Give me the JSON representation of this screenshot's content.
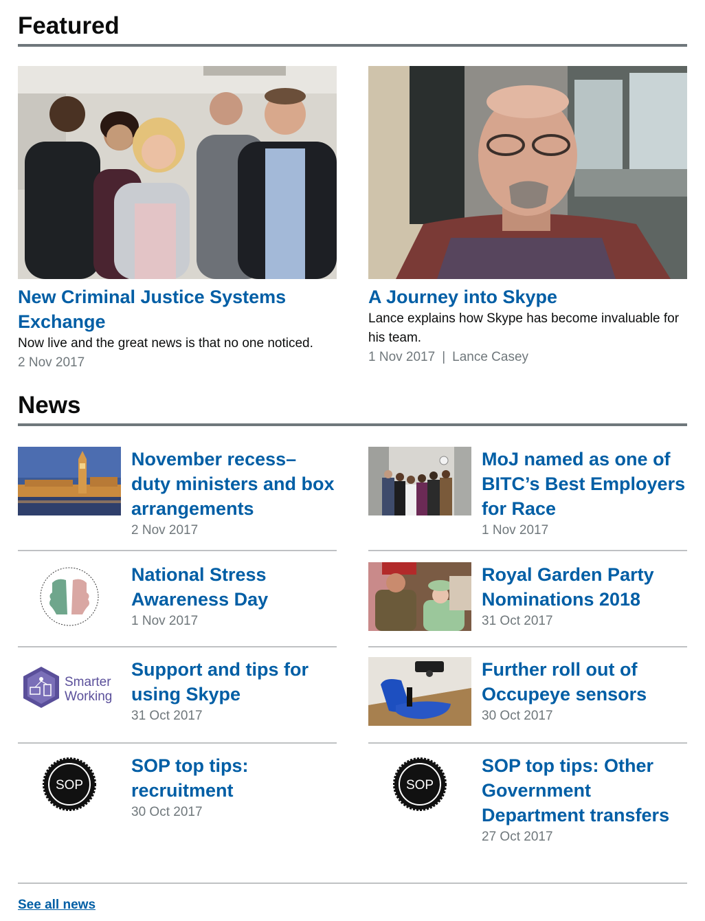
{
  "featured": {
    "heading": "Featured",
    "items": [
      {
        "title": "New Criminal Justice Systems Exchange",
        "description": "Now live and the great news is that no one noticed.",
        "date": "2 Nov 2017",
        "author": ""
      },
      {
        "title": "A Journey into Skype",
        "description": "Lance explains how Skype has become invaluable for his team.",
        "date": "1 Nov 2017",
        "separator": "|",
        "author": "Lance Casey"
      }
    ]
  },
  "news": {
    "heading": "News",
    "items": [
      {
        "title": "November recess– duty ministers and box arrangements",
        "date": "2 Nov 2017"
      },
      {
        "title": "MoJ named as one of BITC’s Best Employers for Race",
        "date": "1 Nov 2017"
      },
      {
        "title": "National Stress Awareness Day",
        "date": "1 Nov 2017"
      },
      {
        "title": "Royal Garden Party Nominations 2018",
        "date": "31 Oct 2017"
      },
      {
        "title": "Support and tips for using Skype",
        "date": "31 Oct 2017"
      },
      {
        "title": "Further roll out of Occupeye sensors",
        "date": "30 Oct 2017"
      },
      {
        "title": "SOP top tips: recruitment",
        "date": "30 Oct 2017"
      },
      {
        "title": "SOP top tips: Other Government Department transfers",
        "date": "27 Oct 2017"
      }
    ],
    "badges": {
      "sop_label": "SOP",
      "smarter_line1": "Smarter",
      "smarter_line2": "Working"
    },
    "see_all": "See all news"
  },
  "colors": {
    "link": "#005ea5",
    "text": "#0b0c0c",
    "secondary": "#6f777b",
    "rule": "#bfc1c3"
  }
}
